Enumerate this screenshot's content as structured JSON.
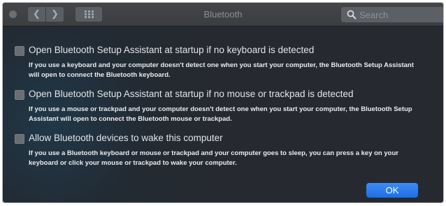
{
  "window": {
    "title": "Bluetooth",
    "nav_back": "❮",
    "nav_forward": "❯",
    "search_placeholder": "Search"
  },
  "options": [
    {
      "label": "Open Bluetooth Setup Assistant at startup if no keyboard is detected",
      "description": "If you use a keyboard and your computer doesn't detect one when you start your computer, the Bluetooth Setup Assistant will open to connect the Bluetooth keyboard.",
      "checked": false
    },
    {
      "label": "Open Bluetooth Setup Assistant at startup if no mouse or trackpad is detected",
      "description": "If you use a mouse or trackpad and your computer doesn't detect one when you start your computer, the Bluetooth Setup Assistant will open to connect the Bluetooth mouse or trackpad.",
      "checked": false
    },
    {
      "label": "Allow Bluetooth devices to wake this computer",
      "description": "If you use a Bluetooth keyboard or mouse or trackpad and your computer goes to sleep, you can press a key on your keyboard or click your mouse or trackpad to wake your computer.",
      "checked": false
    }
  ],
  "buttons": {
    "ok": "OK"
  },
  "colors": {
    "accent": "#2b7cf0",
    "window_bg": "#262a30",
    "text": "#e3e5e8"
  },
  "icons": {
    "close": "window-close-dot",
    "back": "chevron-left-icon",
    "forward": "chevron-right-icon",
    "grid": "show-all-grid-icon",
    "search": "search-icon"
  }
}
